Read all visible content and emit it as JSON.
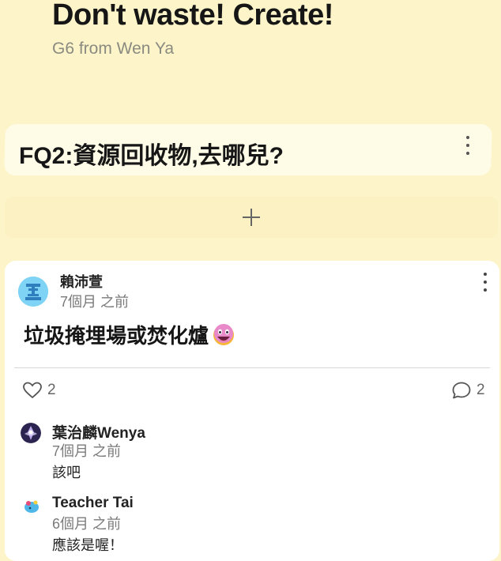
{
  "board": {
    "title": "Don't waste! Create!",
    "subtitle": "G6 from Wen Ya"
  },
  "section": {
    "title": "FQ2:資源回收物,去哪兒?"
  },
  "post": {
    "author": "賴沛萱",
    "time": "7個月 之前",
    "body": "垃圾掩埋場或焚化爐",
    "likes": "2",
    "comments_count": "2"
  },
  "comments": [
    {
      "author": "葉治麟Wenya",
      "time": "7個月 之前",
      "text": "該吧"
    },
    {
      "author": "Teacher Tai",
      "time": "6個月 之前",
      "text": "應該是喔！"
    }
  ],
  "colors": {
    "background": "#fdf5c9",
    "card": "#ffffff",
    "avatar": "#7fd3f5"
  }
}
